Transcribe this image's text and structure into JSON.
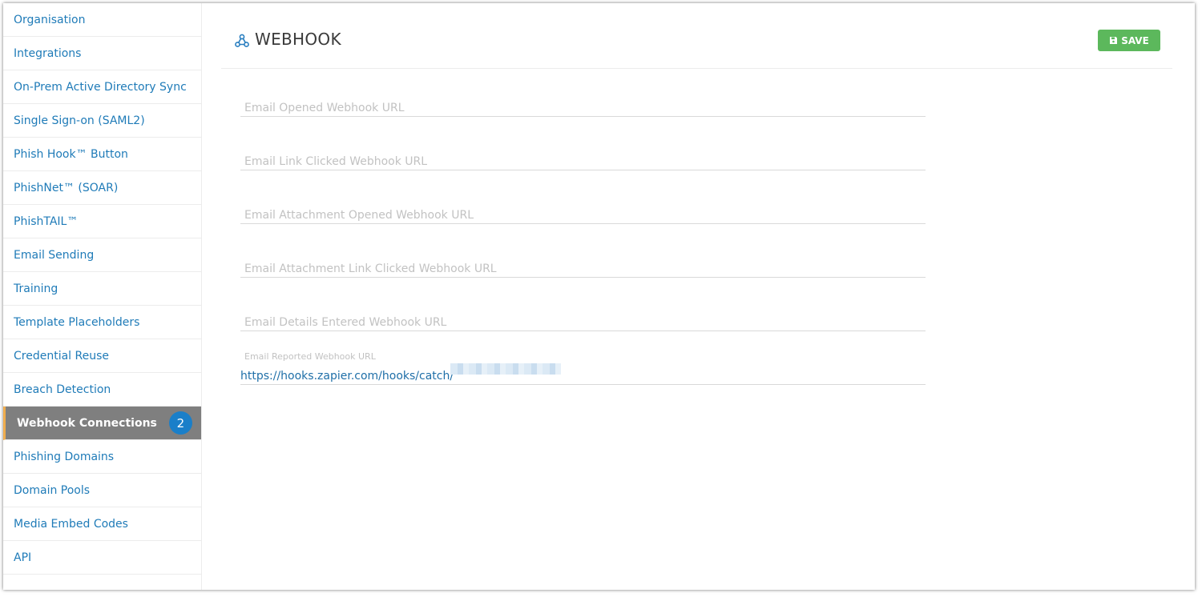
{
  "sidebar": {
    "items": [
      {
        "label": "Organisation"
      },
      {
        "label": "Integrations"
      },
      {
        "label": "On-Prem Active Directory Sync"
      },
      {
        "label": "Single Sign-on (SAML2)"
      },
      {
        "label": "Phish Hook™ Button"
      },
      {
        "label": "PhishNet™ (SOAR)"
      },
      {
        "label": "PhishTAIL™"
      },
      {
        "label": "Email Sending"
      },
      {
        "label": "Training"
      },
      {
        "label": "Template Placeholders"
      },
      {
        "label": "Credential Reuse"
      },
      {
        "label": "Breach Detection"
      },
      {
        "label": "Webhook Connections",
        "badge": "2"
      },
      {
        "label": "Phishing Domains"
      },
      {
        "label": "Domain Pools"
      },
      {
        "label": "Media Embed Codes"
      },
      {
        "label": "API"
      }
    ]
  },
  "header": {
    "title": "WEBHOOK",
    "icon": "webhook-icon",
    "save_label": "SAVE"
  },
  "form": {
    "email_opened": {
      "placeholder": "Email Opened Webhook URL",
      "value": ""
    },
    "link_clicked": {
      "placeholder": "Email Link Clicked Webhook URL",
      "value": ""
    },
    "attachment_opened": {
      "placeholder": "Email Attachment Opened Webhook URL",
      "value": ""
    },
    "attachment_link_clicked": {
      "placeholder": "Email Attachment Link Clicked Webhook URL",
      "value": ""
    },
    "details_entered": {
      "placeholder": "Email Details Entered Webhook URL",
      "value": ""
    },
    "reported": {
      "label": "Email Reported Webhook URL",
      "value": "https://hooks.zapier.com/hooks/catch/"
    }
  },
  "colors": {
    "link": "#1f7bb8",
    "active_bg": "#7f7f7f",
    "badge": "#1a7fc9",
    "save": "#5cb85c",
    "accent_border": "#f0ad4e"
  }
}
